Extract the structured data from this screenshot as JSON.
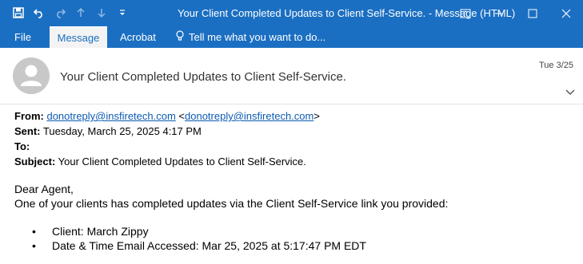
{
  "window": {
    "title": "Your Client Completed Updates to Client Self-Service.  -  Message (HTML)"
  },
  "ribbon": {
    "tabs": [
      {
        "label": "File"
      },
      {
        "label": "Message"
      },
      {
        "label": "Acrobat"
      }
    ],
    "tell_me": "Tell me what you want to do..."
  },
  "header": {
    "subject": "Your Client Completed Updates to Client Self-Service.",
    "date": "Tue 3/25"
  },
  "meta": {
    "from_label": "From:",
    "from_link1": "donotreply@insfiretech.com",
    "from_bracket_open": " <",
    "from_link2": "donotreply@insfiretech.com",
    "from_bracket_close": ">",
    "sent_label": "Sent:",
    "sent_value": " Tuesday, March 25, 2025 4:17 PM",
    "to_label": "To:",
    "subject_label": "Subject:",
    "subject_value": " Your Client Completed Updates to Client Self-Service."
  },
  "body": {
    "greeting": "Dear Agent,",
    "line1": "One of your clients has completed updates via the Client Self-Service link you provided:",
    "bullets": [
      "Client: March Zippy",
      "Date & Time Email Accessed: Mar 25, 2025 at 5:17:47 PM EDT"
    ]
  },
  "colors": {
    "accent": "#1b6fc2",
    "link": "#0b5bb3"
  }
}
